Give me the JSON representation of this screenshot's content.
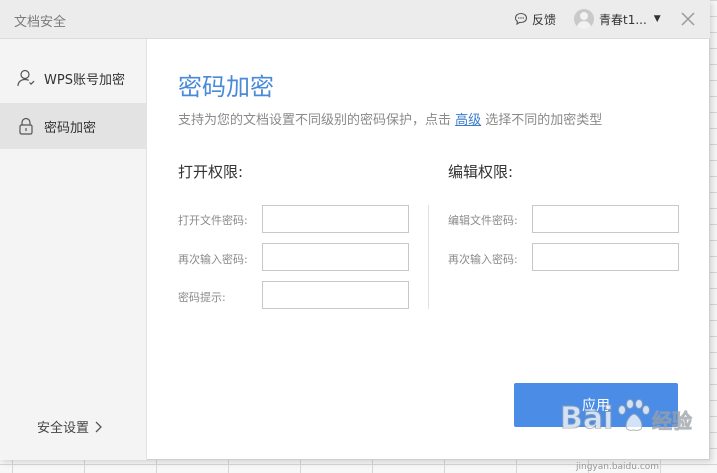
{
  "window": {
    "title": "文档安全",
    "feedback_label": "反馈",
    "user_name": "青春t1..."
  },
  "sidebar": {
    "items": [
      {
        "label": "WPS账号加密",
        "icon": "user-icon",
        "active": false
      },
      {
        "label": "密码加密",
        "icon": "lock-icon",
        "active": true
      }
    ],
    "security_settings_label": "安全设置"
  },
  "main": {
    "title": "密码加密",
    "desc_before": "支持为您的文档设置不同级别的密码保护，点击 ",
    "desc_link": "高级",
    "desc_after": " 选择不同的加密类型",
    "open_section": {
      "title": "打开权限:",
      "fields": [
        {
          "label": "打开文件密码:",
          "value": ""
        },
        {
          "label": "再次输入密码:",
          "value": ""
        },
        {
          "label": "密码提示:",
          "value": ""
        }
      ]
    },
    "edit_section": {
      "title": "编辑权限:",
      "fields": [
        {
          "label": "编辑文件密码:",
          "value": ""
        },
        {
          "label": "再次输入密码:",
          "value": ""
        }
      ]
    },
    "apply_label": "应用"
  },
  "watermark": {
    "text": "jingyan.baidu.com"
  },
  "colors": {
    "accent": "#4a8ad8",
    "button": "#4b8de6",
    "sidebar_bg": "#f4f4f4",
    "sidebar_active": "#e3e3e3"
  }
}
